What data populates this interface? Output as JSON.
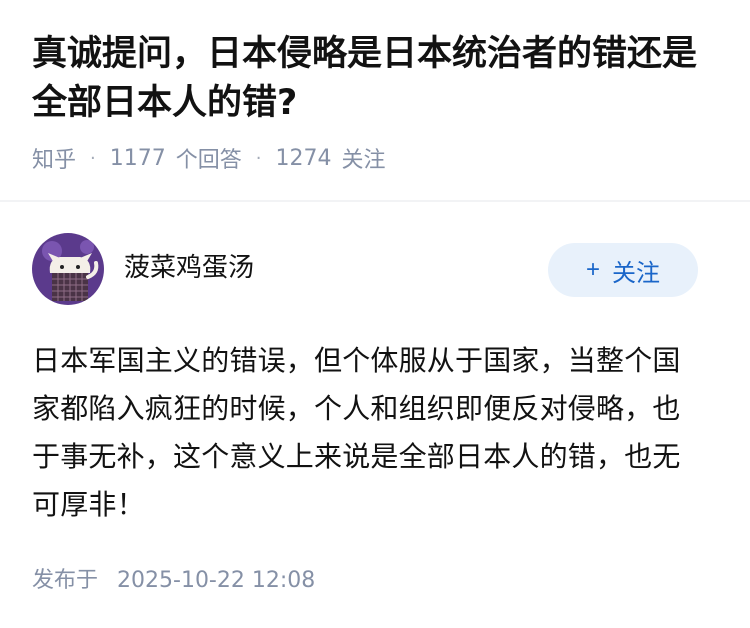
{
  "question": {
    "title": "真诚提问，日本侵略是日本统治者的错还是全部日本人的错?",
    "source": "知乎",
    "answer_count": "1177",
    "answer_label": "个回答",
    "follow_count": "1274",
    "follow_label": "关注"
  },
  "answer": {
    "author_name": "菠菜鸡蛋汤",
    "follow_button_plus": "+",
    "follow_button_label": "关注",
    "content": "日本军国主义的错误，但个体服从于国家，当整个国家都陷入疯狂的时候，个人和组织即便反对侵略，也于事无补，这个意义上来说是全部日本人的错，也无可厚非！",
    "publish_label": "发布于",
    "publish_time": "2025-10-22 12:08"
  },
  "colors": {
    "meta_text": "#8590a6",
    "follow_button_bg": "#e8f1fb",
    "follow_button_text": "#1a66c9",
    "avatar_bg": "#5b3a8c"
  },
  "icons": {
    "avatar": "cartoon-cat-avatar"
  }
}
